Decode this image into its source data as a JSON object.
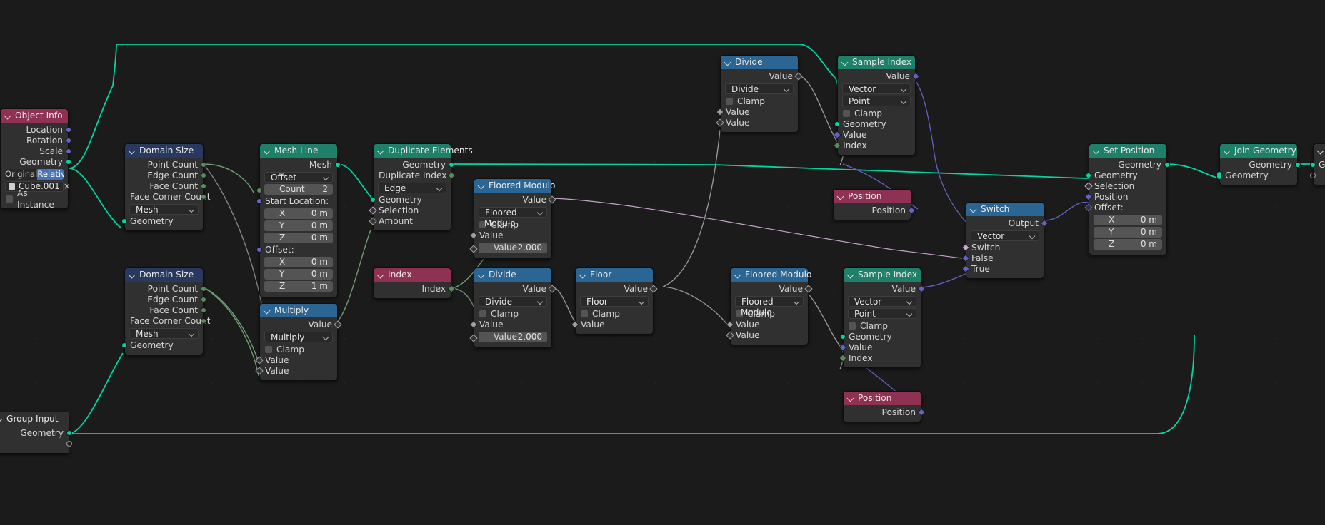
{
  "app": {
    "editor": "Geometry Node Editor",
    "background": "#1b1b1b"
  },
  "colors": {
    "header_geometry": "#1f8069",
    "header_math": "#2a6594",
    "header_input": "#8e3152",
    "header_vector": "#28385e",
    "wire_geometry": "#00d6a3",
    "wire_value": "#9c9c9c",
    "wire_vector": "#6363c7",
    "wire_int": "#6f9a72",
    "wire_bool": "#cca6d6",
    "accent_blue": "#4772b3"
  },
  "nodes": [
    {
      "id": "object-info",
      "title": "Object Info",
      "type": "input",
      "outputs": [
        "Location",
        "Rotation",
        "Scale",
        "Geometry"
      ],
      "toggle": {
        "options": [
          "Original",
          "Relative"
        ],
        "selected": "Relative"
      },
      "object_field": {
        "value": "Cube.001",
        "clear": "×"
      },
      "checkbox": {
        "label": "As Instance",
        "checked": false
      }
    },
    {
      "id": "domain-size-top",
      "title": "Domain Size",
      "type": "vector",
      "outputs": [
        "Point Count",
        "Edge Count",
        "Face Count",
        "Face Corner Count"
      ],
      "dropdown": "Mesh",
      "inputs": [
        "Geometry"
      ]
    },
    {
      "id": "domain-size-bottom",
      "title": "Domain Size",
      "type": "vector",
      "outputs": [
        "Point Count",
        "Edge Count",
        "Face Count",
        "Face Corner Count"
      ],
      "dropdown": "Mesh",
      "inputs": [
        "Geometry"
      ]
    },
    {
      "id": "mesh-line",
      "title": "Mesh Line",
      "type": "geometry",
      "outputs": [
        "Mesh"
      ],
      "mode": "Offset",
      "count": {
        "label": "Count",
        "value": "2"
      },
      "start_location": {
        "label": "Start Location:",
        "x": "0 m",
        "y": "0 m",
        "z": "0 m"
      },
      "offset": {
        "label": "Offset:",
        "x": "0 m",
        "y": "0 m",
        "z": "1 m"
      },
      "axis_labels": {
        "x": "X",
        "y": "Y",
        "z": "Z"
      }
    },
    {
      "id": "duplicate-elements",
      "title": "Duplicate Elements",
      "type": "geometry",
      "outputs": [
        "Geometry",
        "Duplicate Index"
      ],
      "dropdown": "Edge",
      "inputs": [
        "Geometry",
        "Selection",
        "Amount"
      ]
    },
    {
      "id": "index-node",
      "title": "Index",
      "type": "input",
      "outputs": [
        "Index"
      ]
    },
    {
      "id": "multiply",
      "title": "Multiply",
      "type": "math",
      "outputs": [
        "Value"
      ],
      "dropdown": "Multiply",
      "clamp": {
        "label": "Clamp",
        "checked": false
      },
      "inputs": [
        "Value",
        "Value"
      ]
    },
    {
      "id": "floored-modulo-1",
      "title": "Floored Modulo",
      "type": "math",
      "outputs": [
        "Value"
      ],
      "dropdown": "Floored Modulo",
      "clamp": {
        "label": "Clamp",
        "checked": false
      },
      "inputs": [
        "Value"
      ],
      "value_widget": {
        "label": "Value",
        "value": "2.000"
      }
    },
    {
      "id": "divide-1",
      "title": "Divide",
      "type": "math",
      "outputs": [
        "Value"
      ],
      "dropdown": "Divide",
      "clamp": {
        "label": "Clamp",
        "checked": false
      },
      "inputs": [
        "Value"
      ],
      "value_widget": {
        "label": "Value",
        "value": "2.000"
      }
    },
    {
      "id": "floor",
      "title": "Floor",
      "type": "math",
      "outputs": [
        "Value"
      ],
      "dropdown": "Floor",
      "clamp": {
        "label": "Clamp",
        "checked": false
      },
      "inputs": [
        "Value"
      ]
    },
    {
      "id": "divide-2",
      "title": "Divide",
      "type": "math",
      "outputs": [
        "Value"
      ],
      "dropdown": "Divide",
      "clamp": {
        "label": "Clamp",
        "checked": false
      },
      "inputs": [
        "Value",
        "Value"
      ]
    },
    {
      "id": "floored-modulo-2",
      "title": "Floored Modulo",
      "type": "math",
      "outputs": [
        "Value"
      ],
      "dropdown": "Floored Modulo",
      "clamp": {
        "label": "Clamp",
        "checked": false
      },
      "inputs": [
        "Value",
        "Value"
      ]
    },
    {
      "id": "sample-index-top",
      "title": "Sample Index",
      "type": "geometry",
      "outputs": [
        "Value"
      ],
      "dropdown_data": "Vector",
      "dropdown_domain": "Point",
      "clamp": {
        "label": "Clamp",
        "checked": false
      },
      "inputs": [
        "Geometry",
        "Value",
        "Index"
      ]
    },
    {
      "id": "sample-index-bottom",
      "title": "Sample Index",
      "type": "geometry",
      "outputs": [
        "Value"
      ],
      "dropdown_data": "Vector",
      "dropdown_domain": "Point",
      "clamp": {
        "label": "Clamp",
        "checked": false
      },
      "inputs": [
        "Geometry",
        "Value",
        "Index"
      ]
    },
    {
      "id": "position-top",
      "title": "Position",
      "type": "input",
      "outputs": [
        "Position"
      ]
    },
    {
      "id": "position-bottom",
      "title": "Position",
      "type": "input",
      "outputs": [
        "Position"
      ]
    },
    {
      "id": "switch",
      "title": "Switch",
      "type": "math",
      "outputs": [
        "Output"
      ],
      "dropdown": "Vector",
      "inputs": [
        "Switch",
        "False",
        "True"
      ]
    },
    {
      "id": "set-position",
      "title": "Set Position",
      "type": "geometry",
      "outputs": [
        "Geometry"
      ],
      "inputs": [
        "Geometry",
        "Selection",
        "Position",
        "Offset:"
      ],
      "offset": {
        "x": "0 m",
        "y": "0 m",
        "z": "0 m"
      },
      "axis_labels": {
        "x": "X",
        "y": "Y",
        "z": "Z"
      }
    },
    {
      "id": "join-geometry",
      "title": "Join Geometry",
      "type": "geometry",
      "outputs": [
        "Geometry"
      ],
      "inputs": [
        "Geometry"
      ]
    },
    {
      "id": "group-output",
      "title": "",
      "type": "geometry",
      "inputs": [
        "G"
      ]
    },
    {
      "id": "group-input",
      "title": "Group Input",
      "type": "input",
      "outputs": [
        "Geometry",
        ""
      ]
    }
  ]
}
